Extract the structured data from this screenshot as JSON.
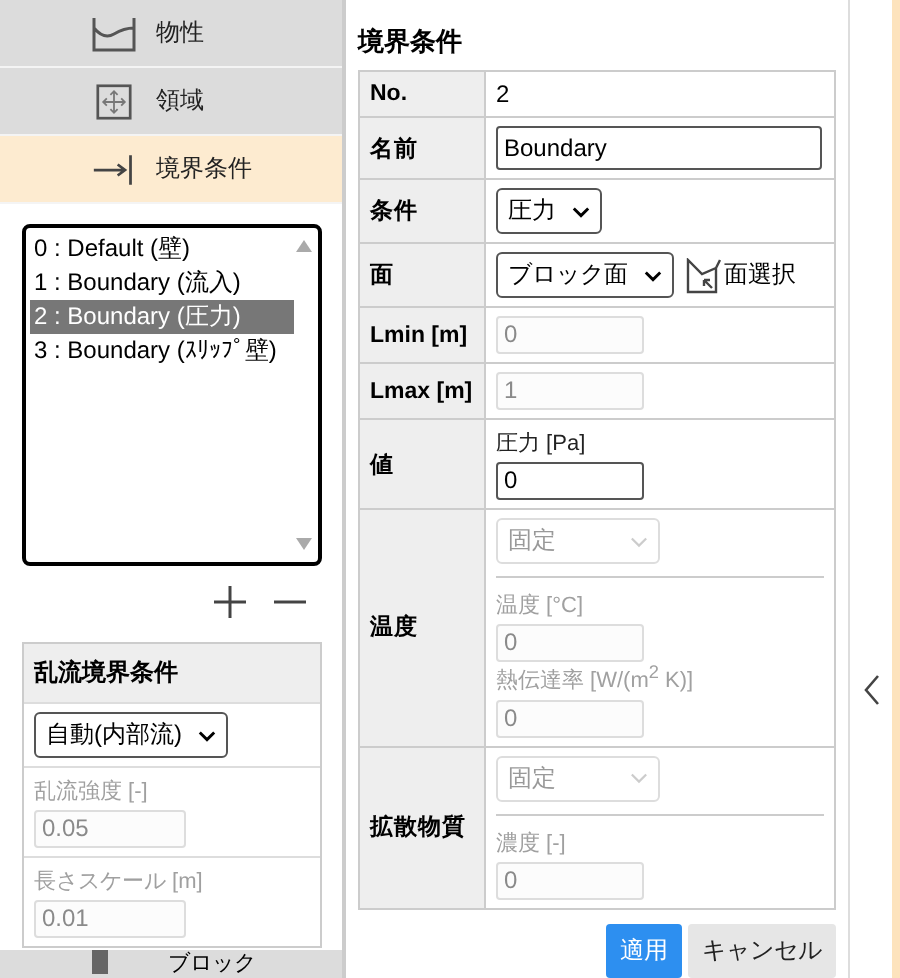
{
  "sidebar": {
    "tabs": [
      {
        "label": "物性",
        "selected": false
      },
      {
        "label": "領域",
        "selected": false
      },
      {
        "label": "境界条件",
        "selected": true
      }
    ],
    "boundary_list": [
      {
        "label": "0 : Default (壁)",
        "selected": false
      },
      {
        "label": "1 : Boundary (流入)",
        "selected": false
      },
      {
        "label": "2 : Boundary (圧力)",
        "selected": true
      },
      {
        "label": "3 : Boundary (ｽﾘｯﾌﾟ壁)",
        "selected": false
      }
    ],
    "turbulence": {
      "title": "乱流境界条件",
      "mode": "自動(内部流)",
      "fields": [
        {
          "label": "乱流強度 [-]",
          "value": "0.05",
          "disabled": true
        },
        {
          "label": "長さスケール [m]",
          "value": "0.01",
          "disabled": true
        }
      ]
    },
    "bottom_tab": {
      "label": "ブロック"
    }
  },
  "form": {
    "title": "境界条件",
    "rows": [
      {
        "kind": "text",
        "label": "No.",
        "value": "2"
      },
      {
        "kind": "input",
        "label": "名前",
        "value": "Boundary",
        "disabled": false
      },
      {
        "kind": "select",
        "label": "条件",
        "value": "圧力",
        "disabled": false
      },
      {
        "kind": "face",
        "label": "面",
        "value": "ブロック面",
        "button": "面選択"
      },
      {
        "kind": "input",
        "label": "Lmin [m]",
        "value": "0",
        "disabled": true
      },
      {
        "kind": "input",
        "label": "Lmax [m]",
        "value": "1",
        "disabled": true
      },
      {
        "kind": "group",
        "label": "値",
        "items": [
          {
            "kind": "field",
            "label": "圧力 [Pa]",
            "value": "0",
            "disabled": false
          }
        ]
      },
      {
        "kind": "group",
        "label": "温度",
        "items": [
          {
            "kind": "select",
            "value": "固定",
            "disabled": true
          },
          {
            "kind": "field",
            "label": "温度 [°C]",
            "value": "0",
            "disabled": true
          },
          {
            "kind": "field",
            "label": "熱伝達率 [W/(m$^{2}$ K)]",
            "value": "0",
            "disabled": true
          }
        ]
      },
      {
        "kind": "group",
        "label": "拡散物質",
        "items": [
          {
            "kind": "select",
            "value": "固定",
            "disabled": true
          },
          {
            "kind": "field",
            "label": "濃度 [-]",
            "value": "0",
            "disabled": true
          }
        ]
      }
    ],
    "buttons": [
      {
        "label": "適用",
        "kind": "primary"
      },
      {
        "label": "キャンセル",
        "kind": "secondary"
      }
    ]
  }
}
